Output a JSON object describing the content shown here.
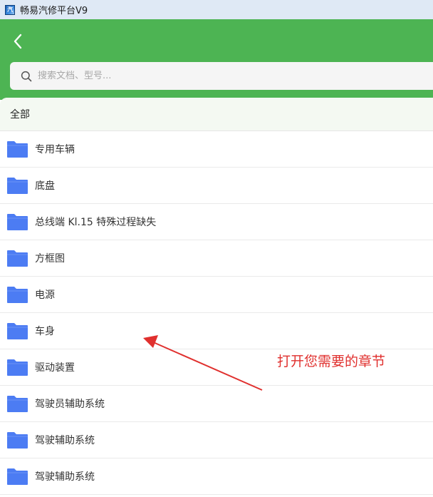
{
  "window": {
    "title": "畅易汽修平台V9",
    "icon": "app-logo-icon"
  },
  "header": {
    "back_icon": "chevron-left-icon",
    "background": "#4db453"
  },
  "search": {
    "placeholder": "搜索文档、型号...",
    "value": "",
    "icon": "search-icon"
  },
  "list": {
    "all_label": "全部",
    "items": [
      {
        "label": "专用车辆",
        "icon": "folder-icon"
      },
      {
        "label": "底盘",
        "icon": "folder-icon"
      },
      {
        "label": "总线端 Kl.15 特殊过程缺失",
        "icon": "folder-icon"
      },
      {
        "label": "方框图",
        "icon": "folder-icon"
      },
      {
        "label": "电源",
        "icon": "folder-icon"
      },
      {
        "label": "车身",
        "icon": "folder-icon"
      },
      {
        "label": "驱动装置",
        "icon": "folder-icon"
      },
      {
        "label": "驾驶员辅助系统",
        "icon": "folder-icon"
      },
      {
        "label": "驾驶辅助系统",
        "icon": "folder-icon"
      },
      {
        "label": "驾驶辅助系统",
        "icon": "folder-icon"
      }
    ]
  },
  "annotation": {
    "text": "打开您需要的章节",
    "color": "#e0302e"
  },
  "colors": {
    "folder": "#4c7cf3",
    "titlebar": "#dfe9f5"
  }
}
